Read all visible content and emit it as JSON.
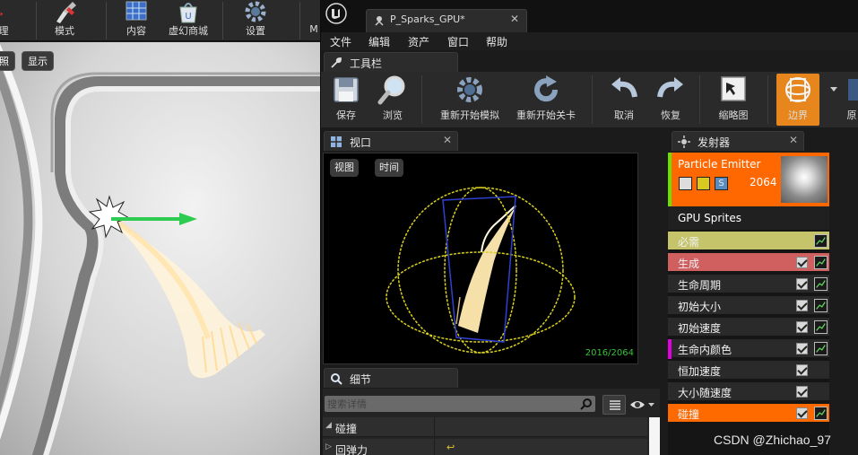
{
  "left_toolbar": {
    "items": [
      {
        "label": "理",
        "icon": "wrench-icon"
      },
      {
        "label": "模式",
        "icon": "brush-icon"
      },
      {
        "label": "内容",
        "icon": "content-grid-icon"
      },
      {
        "label": "虚幻商城",
        "icon": "marketplace-bag-icon"
      },
      {
        "label": "设置",
        "icon": "gear-icon"
      },
      {
        "label": "M",
        "icon": ""
      }
    ]
  },
  "left_viewport": {
    "pill_a": "照",
    "pill_b": "显示"
  },
  "document_tab": {
    "title": "P_Sparks_GPU*"
  },
  "menu": {
    "items": [
      "文件",
      "编辑",
      "资产",
      "窗口",
      "帮助"
    ]
  },
  "toolbar_tab": {
    "title": "工具栏"
  },
  "cascade_toolbar": {
    "save": "保存",
    "browse": "浏览",
    "restart_sim": "重新开始模拟",
    "restart_level": "重新开始关卡",
    "undo": "取消",
    "redo": "恢复",
    "thumbnail": "缩略图",
    "bounds": "边界",
    "next": "原"
  },
  "viewport_panel": {
    "tab_title": "视口",
    "view_button": "视图",
    "time_button": "时间",
    "particle_count": "2016/2064"
  },
  "details_panel": {
    "tab_title": "细节",
    "search_placeholder": "搜索详情",
    "rows": [
      {
        "label": "碰撞",
        "arrow": "◢"
      },
      {
        "label": "回弹力",
        "arrow": "▷"
      }
    ]
  },
  "emitter_panel": {
    "tab_title": "发射器",
    "emitter_name": "Particle Emitter",
    "emitter_count": "2064",
    "emitter_type": "GPU Sprites",
    "modules": [
      {
        "name": "必需",
        "bg": "#c5c46a",
        "accent": "",
        "checkbox": false,
        "graph": true
      },
      {
        "name": "生成",
        "bg": "#d06060",
        "accent": "",
        "checkbox": true,
        "graph": true
      },
      {
        "name": "生命周期",
        "bg": "#2a2a2a",
        "accent": "",
        "checkbox": true,
        "graph": true
      },
      {
        "name": "初始大小",
        "bg": "#2a2a2a",
        "accent": "",
        "checkbox": true,
        "graph": true
      },
      {
        "name": "初始速度",
        "bg": "#2a2a2a",
        "accent": "",
        "checkbox": true,
        "graph": true
      },
      {
        "name": "生命内颜色",
        "bg": "#2a2a2a",
        "accent": "#e000e0",
        "checkbox": true,
        "graph": true
      },
      {
        "name": "恒加速度",
        "bg": "#2a2a2a",
        "accent": "",
        "checkbox": true,
        "graph": false
      },
      {
        "name": "大小随速度",
        "bg": "#2a2a2a",
        "accent": "",
        "checkbox": true,
        "graph": false
      },
      {
        "name": "碰撞",
        "bg": "#ff6a00",
        "accent": "",
        "checkbox": true,
        "graph": true
      }
    ]
  },
  "watermark": "CSDN @Zhichao_97",
  "colors": {
    "accent_orange": "#ff6800",
    "emitter_green": "#6ee000",
    "particle_count_green": "#39c23a",
    "bounds_yellow": "#d8d020",
    "bounds_blue": "#3040d0"
  }
}
